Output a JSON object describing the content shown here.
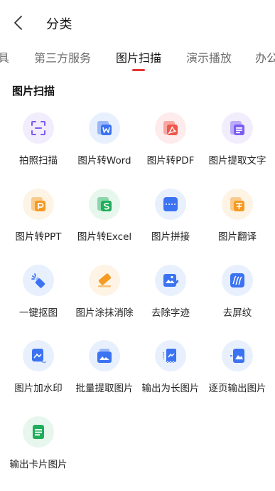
{
  "header": {
    "title": "分类"
  },
  "tabs": [
    {
      "label": "具"
    },
    {
      "label": "第三方服务"
    },
    {
      "label": "图片扫描"
    },
    {
      "label": "演示播放"
    },
    {
      "label": "办公"
    }
  ],
  "section": {
    "title": "图片扫描"
  },
  "items": [
    {
      "label": "拍照扫描",
      "icon": "scan-frame-icon",
      "color": "#7b5cf0"
    },
    {
      "label": "图片转Word",
      "icon": "word-doc-icon",
      "color": "#3b73f2"
    },
    {
      "label": "图片转PDF",
      "icon": "pdf-doc-icon",
      "color": "#f0564a"
    },
    {
      "label": "图片提取文字",
      "icon": "extract-text-icon",
      "color": "#7b5cf0"
    },
    {
      "label": "图片转PPT",
      "icon": "ppt-doc-icon",
      "color": "#f59a23"
    },
    {
      "label": "图片转Excel",
      "icon": "excel-doc-icon",
      "color": "#1fae5b"
    },
    {
      "label": "图片拼接",
      "icon": "stitch-icon",
      "color": "#3b73f2"
    },
    {
      "label": "图片翻译",
      "icon": "translate-icon",
      "color": "#f59a23"
    },
    {
      "label": "一键抠图",
      "icon": "cutout-icon",
      "color": "#3b73f2"
    },
    {
      "label": "图片涂抹消除",
      "icon": "eraser-icon",
      "color": "#f59a23"
    },
    {
      "label": "去除字迹",
      "icon": "remove-handwriting-icon",
      "color": "#3b73f2"
    },
    {
      "label": "去屏纹",
      "icon": "remove-moire-icon",
      "color": "#3b73f2"
    },
    {
      "label": "图片加水印",
      "icon": "watermark-icon",
      "color": "#3b73f2"
    },
    {
      "label": "批量提取图片",
      "icon": "batch-extract-icon",
      "color": "#3b73f2"
    },
    {
      "label": "输出为长图片",
      "icon": "long-image-icon",
      "color": "#3b73f2"
    },
    {
      "label": "逐页输出图片",
      "icon": "page-output-icon",
      "color": "#3b73f2"
    },
    {
      "label": "输出卡片图片",
      "icon": "card-image-icon",
      "color": "#1fae5b"
    }
  ]
}
